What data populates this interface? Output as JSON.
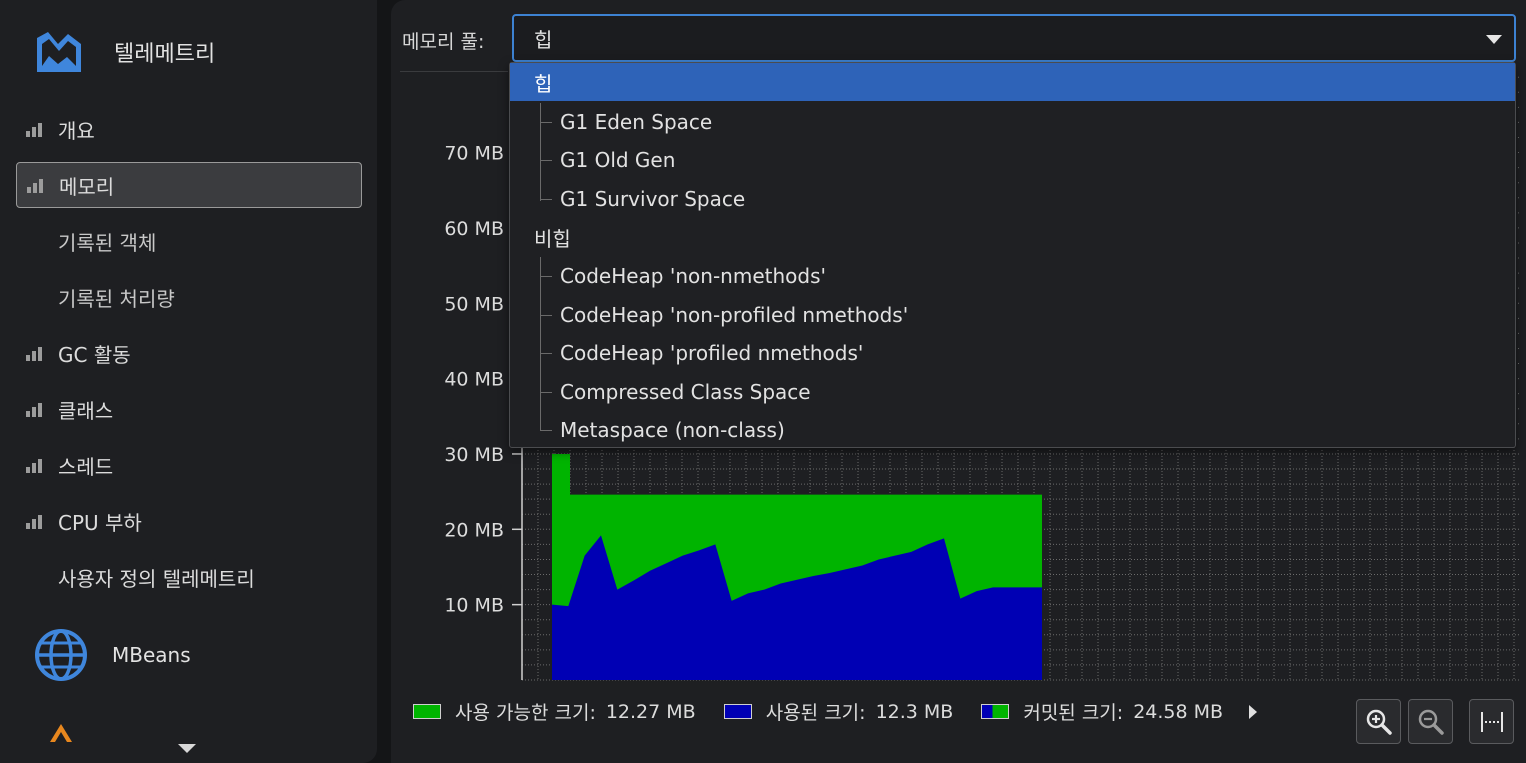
{
  "sidebar": {
    "header_label": "텔레메트리",
    "items": [
      {
        "label": "개요"
      },
      {
        "label": "메모리"
      },
      {
        "label": "기록된 객체"
      },
      {
        "label": "기록된 처리량"
      },
      {
        "label": "GC 활동"
      },
      {
        "label": "클래스"
      },
      {
        "label": "스레드"
      },
      {
        "label": "CPU 부하"
      },
      {
        "label": "사용자 정의 텔레메트리"
      }
    ],
    "mbeans_label": "MBeans"
  },
  "pool": {
    "label": "메모리 풀:",
    "selected": "힙",
    "options": [
      {
        "label": "힙"
      },
      {
        "label": "G1 Eden Space"
      },
      {
        "label": "G1 Old Gen"
      },
      {
        "label": "G1 Survivor Space"
      },
      {
        "label": "비힙"
      },
      {
        "label": "CodeHeap 'non-nmethods'"
      },
      {
        "label": "CodeHeap 'non-profiled nmethods'"
      },
      {
        "label": "CodeHeap 'profiled nmethods'"
      },
      {
        "label": "Compressed Class Space"
      },
      {
        "label": "Metaspace (non-class)"
      }
    ]
  },
  "chart_data": {
    "type": "area",
    "y_ticks": [
      "10 MB",
      "20 MB",
      "30 MB",
      "40 MB",
      "50 MB",
      "60 MB",
      "70 MB"
    ],
    "ylim": [
      0,
      75
    ],
    "grid": true,
    "x": [
      0,
      1,
      2,
      3,
      4,
      5,
      6,
      7,
      8,
      9,
      10,
      11,
      12,
      13,
      14,
      15,
      16,
      17,
      18,
      19,
      20,
      21,
      22,
      23,
      24,
      25,
      26,
      27,
      28,
      29,
      30
    ],
    "series": [
      {
        "name": "사용된 크기",
        "color": "#0000b4",
        "values": [
          10.0,
          9.8,
          16.5,
          19.2,
          12.0,
          13.2,
          14.5,
          15.5,
          16.5,
          17.2,
          18.0,
          10.5,
          11.5,
          12.0,
          12.8,
          13.3,
          13.8,
          14.2,
          14.7,
          15.2,
          16.0,
          16.5,
          17.0,
          18.0,
          18.8,
          10.8,
          11.8,
          12.3,
          12.3,
          12.3,
          12.3
        ]
      },
      {
        "name": "커밋된 크기",
        "color": "#00b400",
        "values": [
          30.0,
          24.6,
          24.6,
          24.6,
          24.6,
          24.6,
          24.6,
          24.6,
          24.6,
          24.6,
          24.6,
          24.6,
          24.6,
          24.6,
          24.6,
          24.6,
          24.6,
          24.6,
          24.6,
          24.6,
          24.6,
          24.6,
          24.6,
          24.6,
          24.6,
          24.6,
          24.6,
          24.6,
          24.6,
          24.6,
          24.6
        ]
      }
    ]
  },
  "legend": [
    {
      "label": "사용 가능한 크기:",
      "value": "12.27 MB",
      "color": "#00b400"
    },
    {
      "label": "사용된 크기:",
      "value": "12.3 MB",
      "color": "#0000b4"
    },
    {
      "label": "커밋된 크기:",
      "value": "24.58 MB",
      "color": "#00b400"
    }
  ]
}
